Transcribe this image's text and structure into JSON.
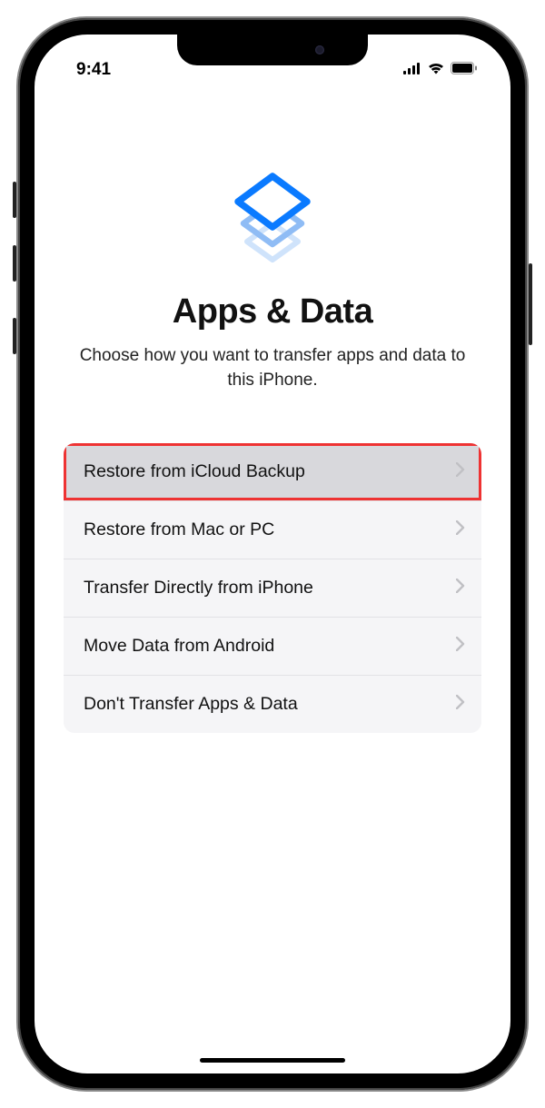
{
  "status": {
    "time": "9:41"
  },
  "header": {
    "title": "Apps & Data",
    "subtitle": "Choose how you want to transfer apps and data to this iPhone."
  },
  "options": [
    {
      "label": "Restore from iCloud Backup",
      "highlighted": true
    },
    {
      "label": "Restore from Mac or PC",
      "highlighted": false
    },
    {
      "label": "Transfer Directly from iPhone",
      "highlighted": false
    },
    {
      "label": "Move Data from Android",
      "highlighted": false
    },
    {
      "label": "Don't Transfer Apps & Data",
      "highlighted": false
    }
  ]
}
